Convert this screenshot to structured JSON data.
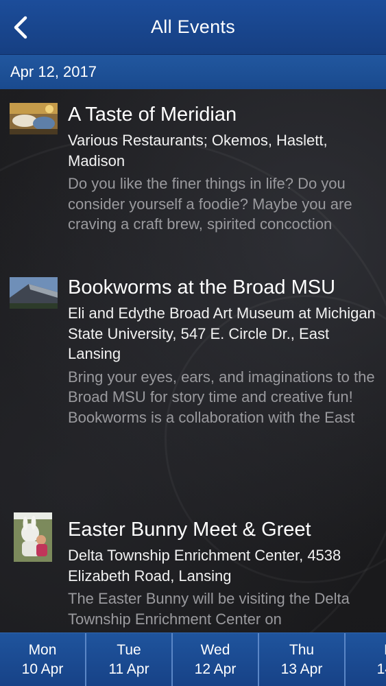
{
  "header": {
    "title": "All Events"
  },
  "date_bar": {
    "date": "Apr 12, 2017"
  },
  "events": [
    {
      "title": "A Taste of Meridian",
      "location": "Various Restaurants; Okemos, Haslett, Madison",
      "description": "Do you like the finer things in life? Do you consider yourself a foodie? Maybe you are craving a craft brew, spirited concoction"
    },
    {
      "title": "Bookworms at the Broad MSU",
      "location": "Eli and Edythe Broad Art Museum at Michigan State University, 547 E. Circle Dr., East Lansing",
      "description": "Bring your eyes, ears, and imaginations to the Broad MSU for story time and creative fun! Bookworms is a collaboration with the East"
    },
    {
      "title": "Easter Bunny Meet & Greet",
      "location": "Delta Township Enrichment Center, 4538 Elizabeth Road, Lansing",
      "description": "The Easter Bunny will be visiting the Delta Township Enrichment Center on"
    }
  ],
  "day_tabs": [
    {
      "day": "Mon",
      "date": "10 Apr"
    },
    {
      "day": "Tue",
      "date": "11 Apr"
    },
    {
      "day": "Wed",
      "date": "12 Apr"
    },
    {
      "day": "Thu",
      "date": "13 Apr"
    },
    {
      "day": "F",
      "date": "14"
    }
  ]
}
